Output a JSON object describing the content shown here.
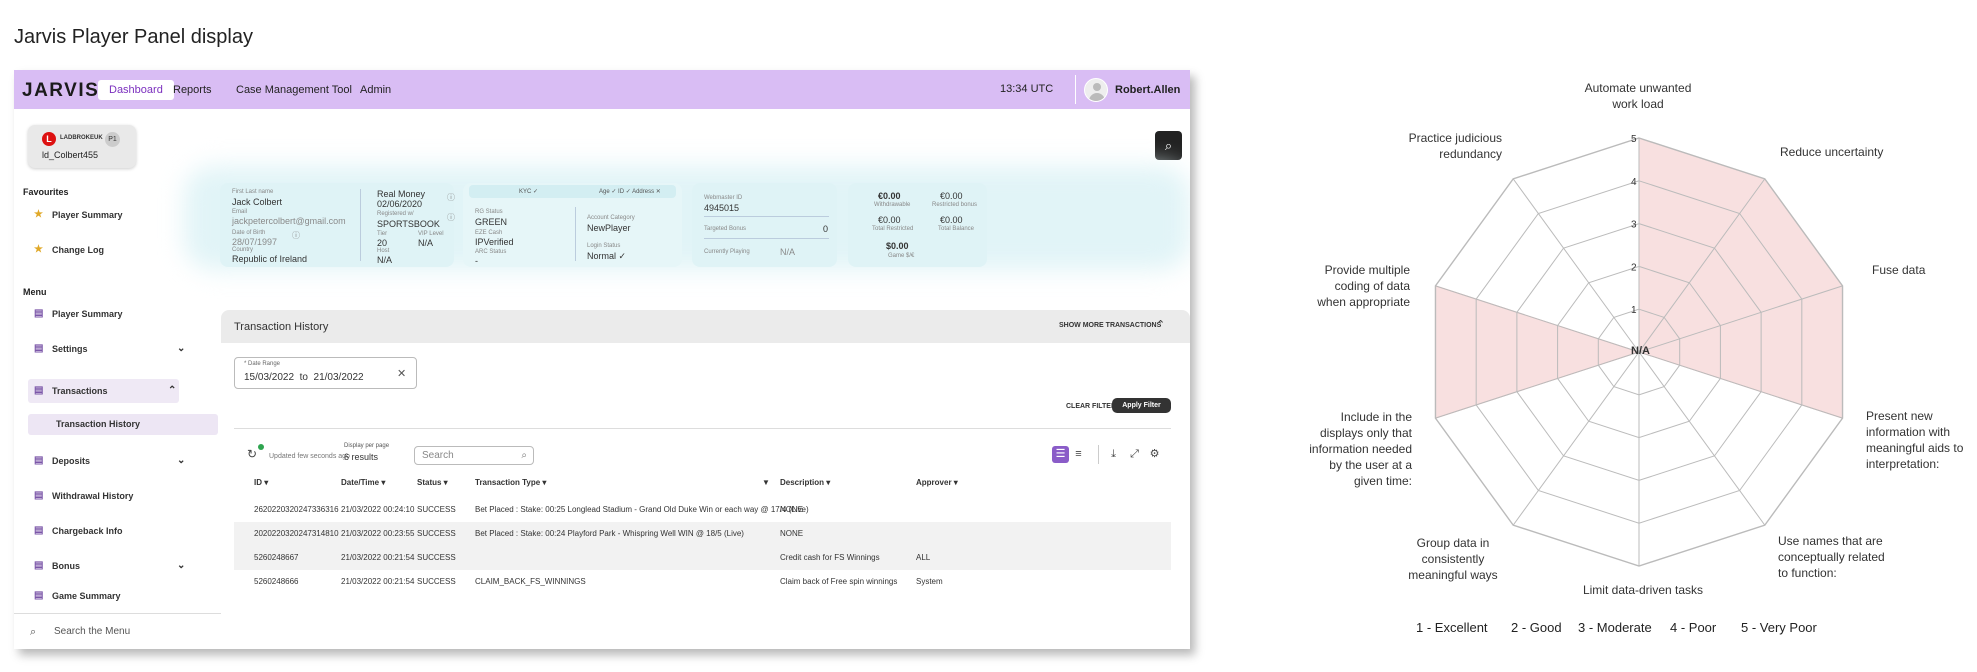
{
  "page_title": "Jarvis Player Panel display",
  "topbar": {
    "logo": "JARVIS",
    "nav": [
      "Dashboard",
      "Reports",
      "Case Management Tool",
      "Admin"
    ],
    "time": "13:34 UTC",
    "user": "Robert.Allen"
  },
  "brand": {
    "name": "LADBROKEUK",
    "badge": "P1",
    "account": "ld_Colbert455"
  },
  "sidebar": {
    "favourites_title": "Favourites",
    "favourites": [
      "Player Summary",
      "Change Log"
    ],
    "menu_title": "Menu",
    "menu": [
      "Player Summary",
      "Settings",
      "Transactions",
      "Deposits",
      "Withdrawal History",
      "Chargeback Info",
      "Bonus",
      "Game Summary"
    ],
    "sub_item": "Transaction History",
    "search_placeholder": "Search the Menu"
  },
  "player_card": {
    "name_label": "First Last name",
    "name": "Jack Colbert",
    "email_label": "Email",
    "email": "jackpetercolbert@gmail.com",
    "dob_label": "Date of Birth",
    "dob": "28/07/1997",
    "country_label": "Country",
    "country": "Republic of Ireland",
    "money_label": "Real Money",
    "money_date": "02/06/2020",
    "registered_label": "Registered w/",
    "registered": "SPORTSBOOK",
    "tier_label": "Tier",
    "tier": "20",
    "vip_label": "VIP Level",
    "vip": "N/A",
    "host_label": "Host",
    "host": "N/A"
  },
  "kyc_card": {
    "kyc": "KYC ✓",
    "checks": "Age ✓ ID ✓ Address ✕",
    "rg_label": "RG Status",
    "rg": "GREEN",
    "eze_label": "EZE Cash",
    "eze": "IPVerified",
    "arc_label": "ARC Status",
    "arc": "-",
    "category_label": "Account Category",
    "category": "NewPlayer",
    "login_label": "Login Status",
    "login": "Normal ✓"
  },
  "web_card": {
    "id_label": "Webmaster ID",
    "id": "4945015",
    "bonus_label": "Targeted Bonus",
    "bonus": "0",
    "playing_label": "Currently Playing",
    "playing": "N/A"
  },
  "balance_card": {
    "withdrawable": "€0.00",
    "withdrawable_label": "Withdrawable",
    "restricted_bonus": "€0.00",
    "restricted_bonus_label": "Restricted bonus",
    "total_restricted": "€0.00",
    "total_restricted_label": "Total Restricted",
    "total_balance": "€0.00",
    "total_balance_label": "Total Balance",
    "game_value": "$0.00",
    "game_label": "Game $/€"
  },
  "transactions": {
    "title": "Transaction History",
    "show_more": "SHOW MORE TRANSACTIONS",
    "date_label": "* Date Range",
    "date_from": "15/03/2022",
    "date_to_word": "to",
    "date_to": "21/03/2022",
    "clear": "CLEAR FILTER",
    "apply": "Apply Filter",
    "updated": "Updated few seconds ago",
    "dpp_label": "Display per page",
    "dpp_value": "6 results",
    "search_placeholder": "Search",
    "columns": [
      "ID ▾",
      "Date/Time ▾",
      "Status ▾",
      "Transaction Type ▾",
      "Description ▾",
      "Approver ▾"
    ],
    "rows": [
      [
        "2620220320247336316",
        "21/03/2022 00:24:10",
        "SUCCESS",
        "Bet Placed : Stake: 00:25 Longlead Stadium - Grand Old Duke Win or each way @ 17/4 (Live)",
        "NONE",
        ""
      ],
      [
        "2020220320247314810",
        "21/03/2022 00:23:55",
        "SUCCESS",
        "Bet Placed : Stake: 00:24 Playford Park - Whispring Well WIN @ 18/5 (Live)",
        "NONE",
        ""
      ],
      [
        "5260248667",
        "21/03/2022 00:21:54",
        "SUCCESS",
        "",
        "Credit cash for FS Winnings",
        "ALL"
      ],
      [
        "5260248666",
        "21/03/2022 00:21:54",
        "SUCCESS",
        "CLAIM_BACK_FS_WINNINGS",
        "Claim back of Free spin winnings",
        "System"
      ]
    ]
  },
  "radar": {
    "axis_labels": [
      "Automate unwanted work load",
      "Reduce uncertainty",
      "Fuse data",
      "Present new information with meaningful aids to interpretation:",
      "Use names that are conceptually related to function:",
      "Limit data-driven tasks",
      "Group data in consistently meaningful ways",
      "Include in the displays only that information needed by the user at a given time:",
      "Provide multiple coding of data when appropriate",
      "Practice judicious redundancy"
    ],
    "ticks": [
      "N/A",
      "1",
      "2",
      "3",
      "4",
      "5"
    ],
    "legend": [
      "1 - Excellent",
      "2 - Good",
      "3 - Moderate",
      "4 - Poor",
      "5 - Very Poor"
    ],
    "colors": {
      "fill": "#f8e0e0",
      "stroke": "#f0c4c4",
      "grid": "#bbbbbb"
    }
  },
  "chart_data": {
    "type": "radar",
    "categories": [
      "Automate unwanted work load",
      "Reduce uncertainty",
      "Fuse data",
      "Present new information with meaningful aids to interpretation:",
      "Use names that are conceptually related to function:",
      "Limit data-driven tasks",
      "Group data in consistently meaningful ways",
      "Include in the displays only that information needed by the user at a given time:",
      "Provide multiple coding of data when appropriate",
      "Practice judicious redundancy"
    ],
    "values": [
      5,
      5,
      5,
      5,
      0,
      0,
      0,
      5,
      5,
      0
    ],
    "range": [
      0,
      5
    ]
  }
}
